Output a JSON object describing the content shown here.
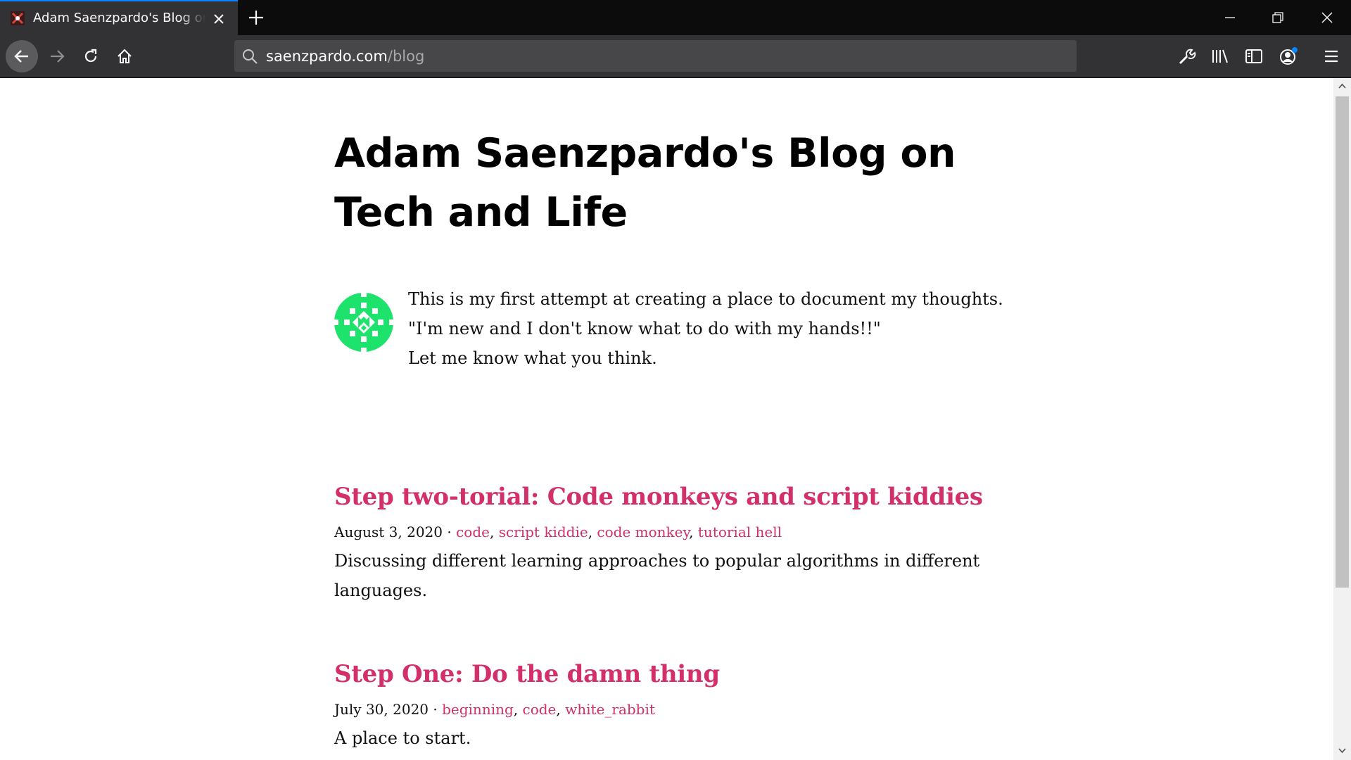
{
  "browser": {
    "tab_title": "Adam Saenzpardo's Blog on Tech and Life",
    "url_domain": "saenzpardo.com",
    "url_path": "/blog",
    "accent_color": "#0a84ff"
  },
  "site": {
    "title_line1": "Adam Saenzpardo's Blog on",
    "title_line2": "Tech and Life",
    "intro_lines": [
      "This is my first attempt at creating a place to document my thoughts.",
      "\"I'm new and I don't know what to do with my hands!!\"",
      "Let me know what you think."
    ],
    "link_color": "#d32f6a",
    "avatar_color": "#1de26b"
  },
  "posts": [
    {
      "title": "Step two-torial: Code monkeys and script kiddies",
      "date": "August 3, 2020",
      "tags": [
        "code",
        "script kiddie",
        "code monkey",
        "tutorial hell"
      ],
      "description": "Discussing different learning approaches to popular algorithms in different languages."
    },
    {
      "title": "Step One: Do the damn thing",
      "date": "July 30, 2020",
      "tags": [
        "beginning",
        "code",
        "white_rabbit"
      ],
      "description": "A place to start."
    }
  ]
}
